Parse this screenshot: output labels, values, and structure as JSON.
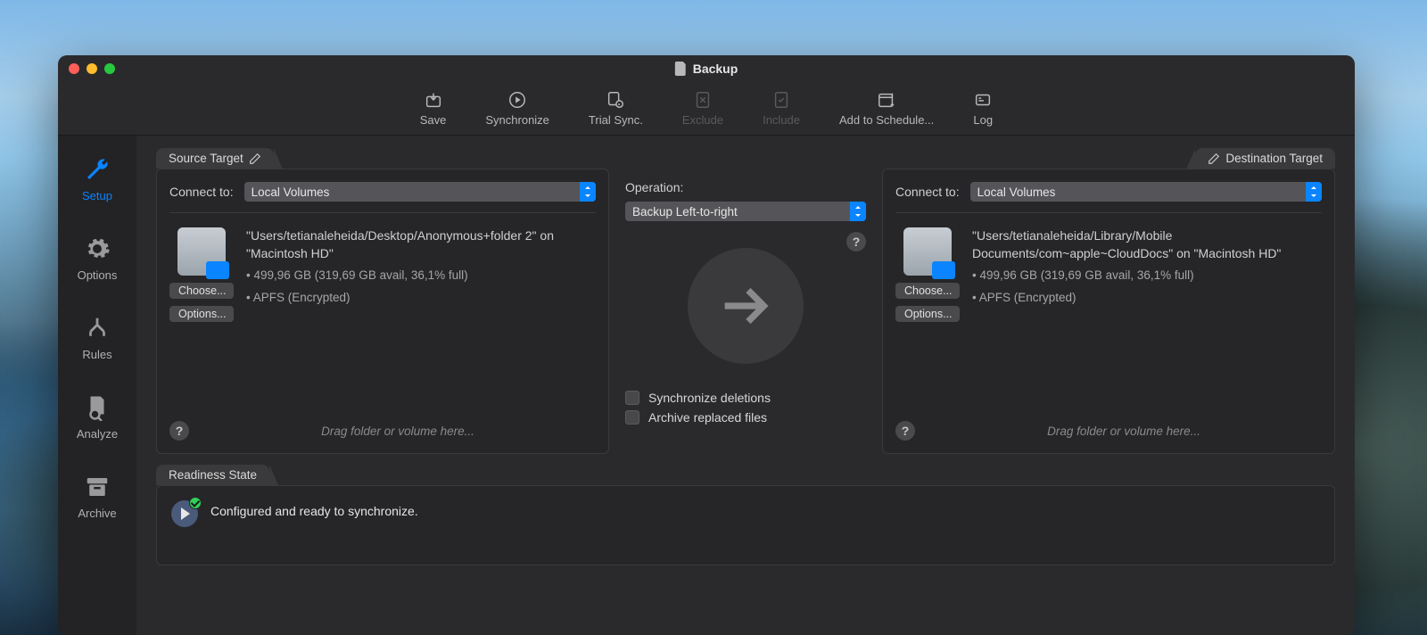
{
  "window": {
    "title": "Backup"
  },
  "toolbar": {
    "save": "Save",
    "synchronize": "Synchronize",
    "trial_sync": "Trial Sync.",
    "exclude": "Exclude",
    "include": "Include",
    "add_schedule": "Add to Schedule...",
    "log": "Log"
  },
  "sidebar": {
    "setup": "Setup",
    "options": "Options",
    "rules": "Rules",
    "analyze": "Analyze",
    "archive": "Archive"
  },
  "source": {
    "tab": "Source Target",
    "connect_label": "Connect to:",
    "connect_value": "Local Volumes",
    "path": "\"Users/tetianaleheida/Desktop/Anonymous+folder 2\" on \"Macintosh HD\"",
    "size": "• 499,96 GB (319,69 GB avail, 36,1% full)",
    "fs": "• APFS (Encrypted)",
    "choose": "Choose...",
    "options": "Options...",
    "drag_hint": "Drag folder or volume here..."
  },
  "operation": {
    "label": "Operation:",
    "value": "Backup Left-to-right",
    "sync_deletions": "Synchronize deletions",
    "archive_replaced": "Archive replaced files"
  },
  "destination": {
    "tab": "Destination Target",
    "connect_label": "Connect to:",
    "connect_value": "Local Volumes",
    "path": "\"Users/tetianaleheida/Library/Mobile Documents/com~apple~CloudDocs\" on \"Macintosh HD\"",
    "size": "• 499,96 GB (319,69 GB avail, 36,1% full)",
    "fs": "• APFS (Encrypted)",
    "choose": "Choose...",
    "options": "Options...",
    "drag_hint": "Drag folder or volume here..."
  },
  "readiness": {
    "tab": "Readiness State",
    "text": "Configured and ready to synchronize."
  }
}
